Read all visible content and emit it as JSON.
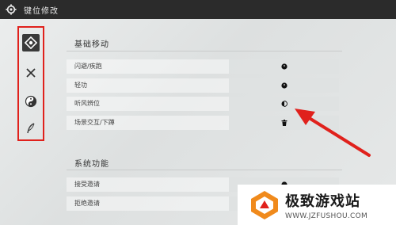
{
  "window": {
    "title": "键位修改"
  },
  "sidebar": {
    "items": [
      {
        "icon": "diamond-target-icon",
        "active": true
      },
      {
        "icon": "crossed-swords-icon",
        "active": false
      },
      {
        "icon": "yin-yang-icon",
        "active": false
      },
      {
        "icon": "feather-icon",
        "active": false
      }
    ]
  },
  "sections": [
    {
      "title": "基础移动",
      "rows": [
        {
          "label": "闪避/疾跑",
          "key_icon": "mouse-icon"
        },
        {
          "label": "轻功",
          "key_icon": "mouse-icon"
        },
        {
          "label": "听风辨位",
          "key_icon": "mouse-icon"
        },
        {
          "label": "场景交互/下蹲",
          "key_icon": "trash-icon"
        }
      ]
    },
    {
      "title": "系统功能",
      "rows": [
        {
          "label": "接受邀请",
          "key_icon": "mouse-icon"
        },
        {
          "label": "拒绝邀请",
          "key_icon": "mouse-icon"
        }
      ]
    }
  ],
  "watermark": {
    "name": "极致游戏站",
    "url": "WWW.JZFUSHOU.COM"
  },
  "colors": {
    "highlight": "#e0211c",
    "titlebar": "#2b2b2b",
    "logo_orange": "#f08a1c"
  }
}
